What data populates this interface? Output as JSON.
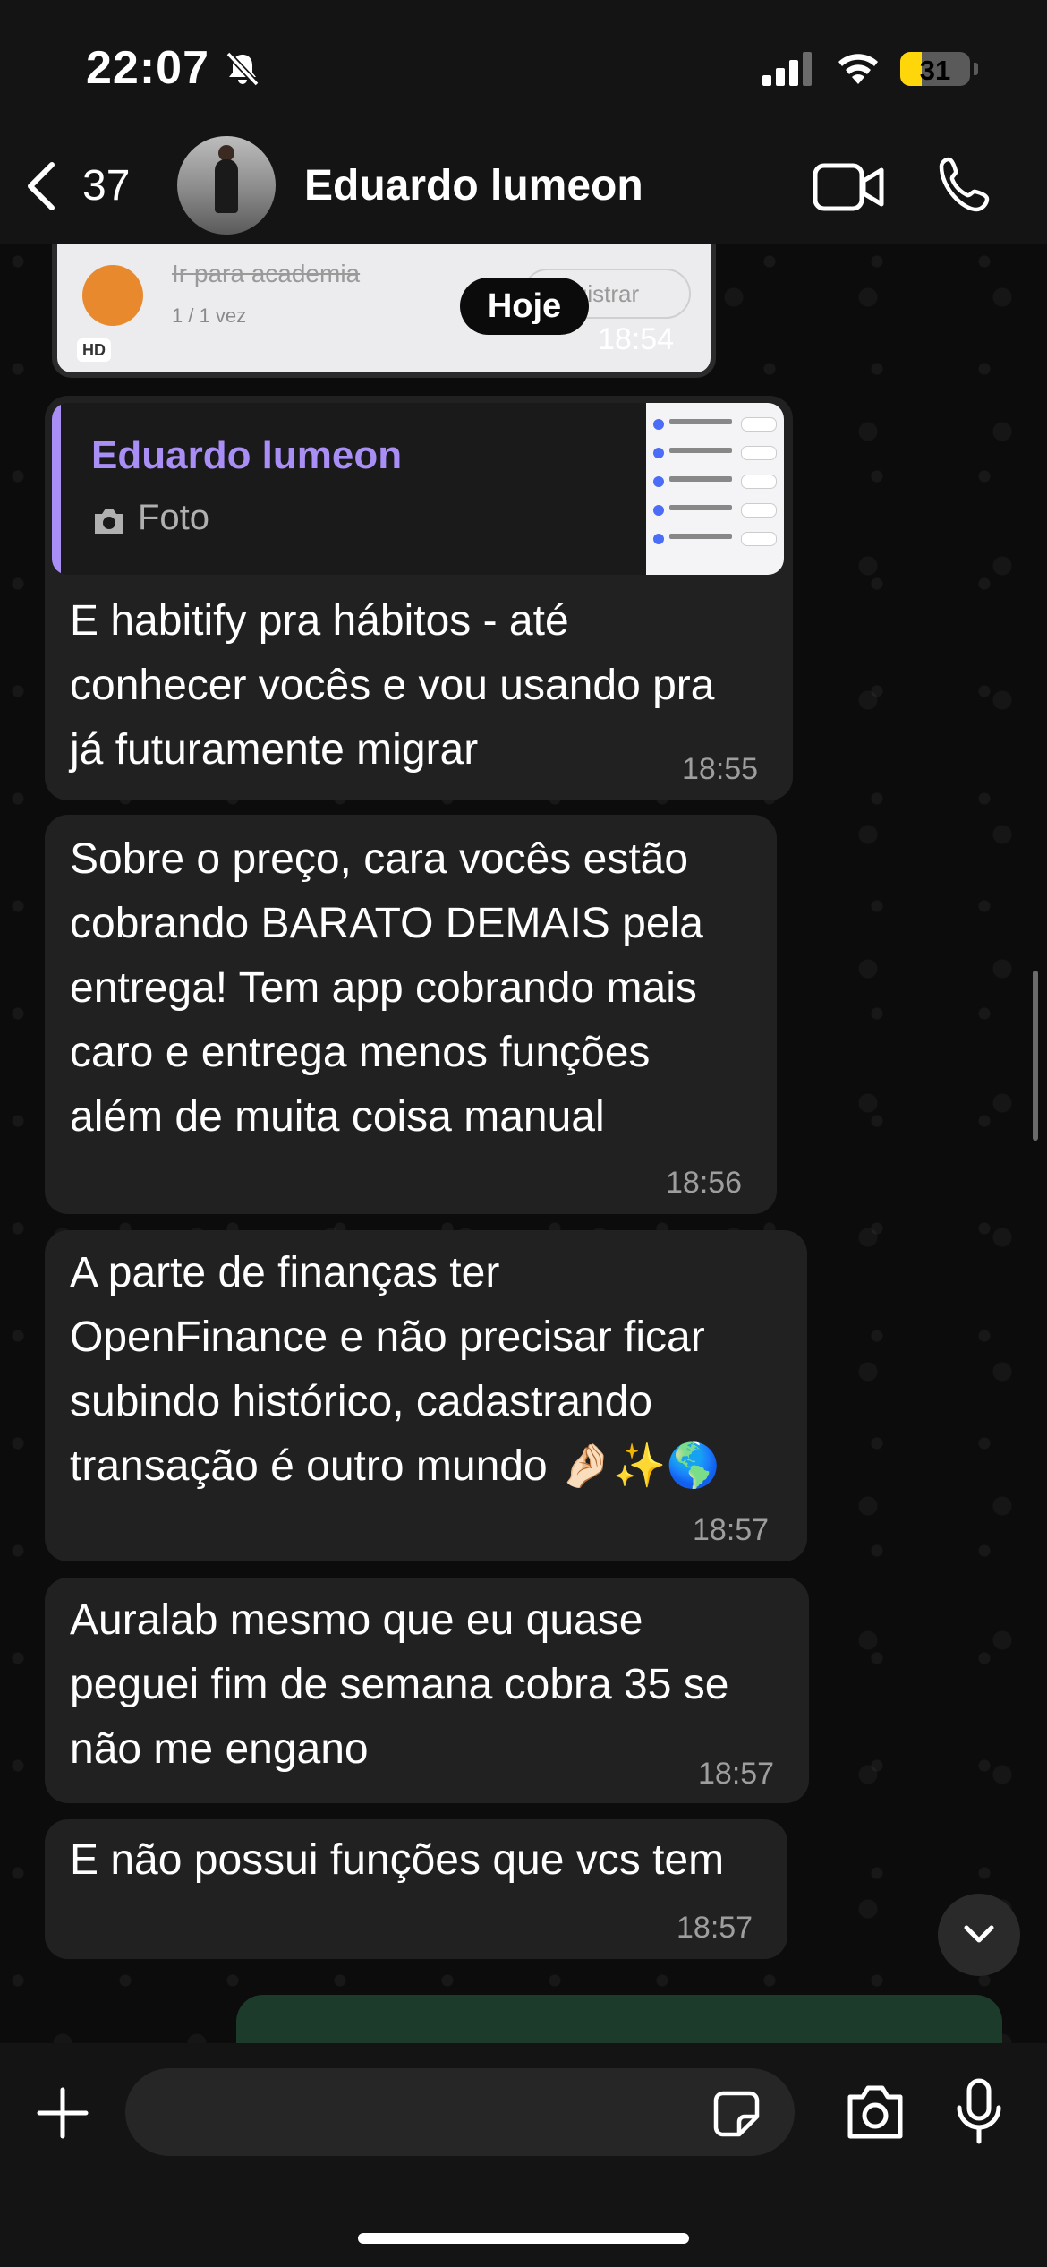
{
  "status_bar": {
    "time": "22:07",
    "battery": "31",
    "battery_level": 0.31
  },
  "header": {
    "back_count": "37",
    "contact_name": "Eduardo lumeon"
  },
  "media_card": {
    "habit_title": "Ir para academia",
    "habit_count": "1 / 1 vez",
    "register_label": "gistrar",
    "hd_badge": "HD",
    "time": "18:54"
  },
  "day_separator": "Hoje",
  "messages": [
    {
      "quote_author": "Eduardo lumeon",
      "quote_type": "Foto",
      "text": "E habitify pra hábitos - até\nconhecer vocês e vou usando pra\njá futuramente migrar",
      "time": "18:55"
    },
    {
      "text": "Sobre o preço, cara vocês estão\ncobrando BARATO DEMAIS pela\nentrega! Tem app cobrando mais\ncaro e entrega menos funções\nalém de muita coisa manual",
      "time": "18:56"
    },
    {
      "text": "A parte de finanças ter\nOpenFinance e não precisar ficar\nsubindo histórico, cadastrando\ntransação é outro mundo 🤌🏻✨🌎",
      "time": "18:57"
    },
    {
      "text": "Auralab mesmo que eu quase\npeguei fim de semana cobra 35 se\nnão me engano",
      "time": "18:57"
    },
    {
      "text": "E não possui funções que vcs tem",
      "time": "18:57"
    }
  ],
  "composer": {
    "placeholder": ""
  },
  "colors": {
    "bubble": "#212121",
    "quote_accent": "#a88ef5",
    "battery_fill": "#ffd60a"
  }
}
